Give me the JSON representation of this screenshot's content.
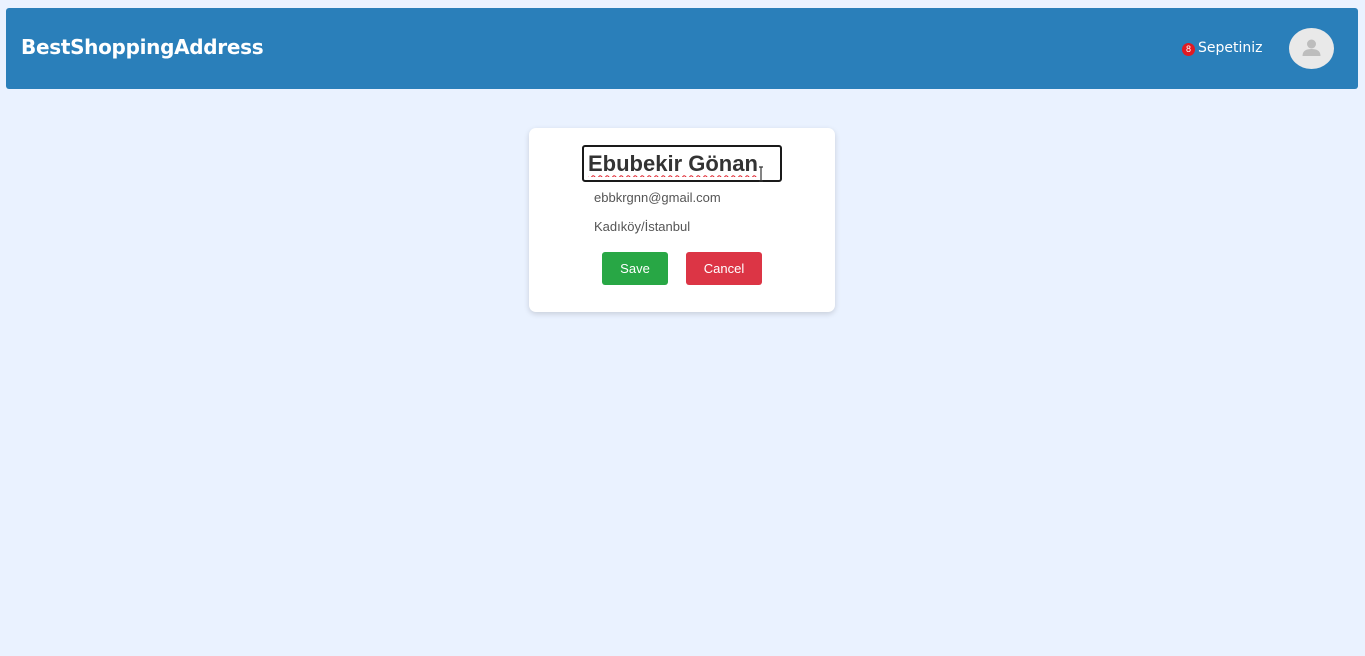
{
  "header": {
    "brand": "BestShoppingAddress",
    "cart_count": "8",
    "cart_label": "Sepetiniz",
    "avatar_icon": "user-avatar-icon",
    "background_color": "#2a7fba"
  },
  "profile": {
    "name_value": "Ebubekir Gönan",
    "email": "ebbkrgnn@gmail.com",
    "address": "Kadıköy/İstanbul",
    "save_label": "Save",
    "cancel_label": "Cancel"
  },
  "colors": {
    "page_background": "#eaf2ff",
    "save": "#28a745",
    "cancel": "#dc3545",
    "badge": "#e11a22"
  }
}
